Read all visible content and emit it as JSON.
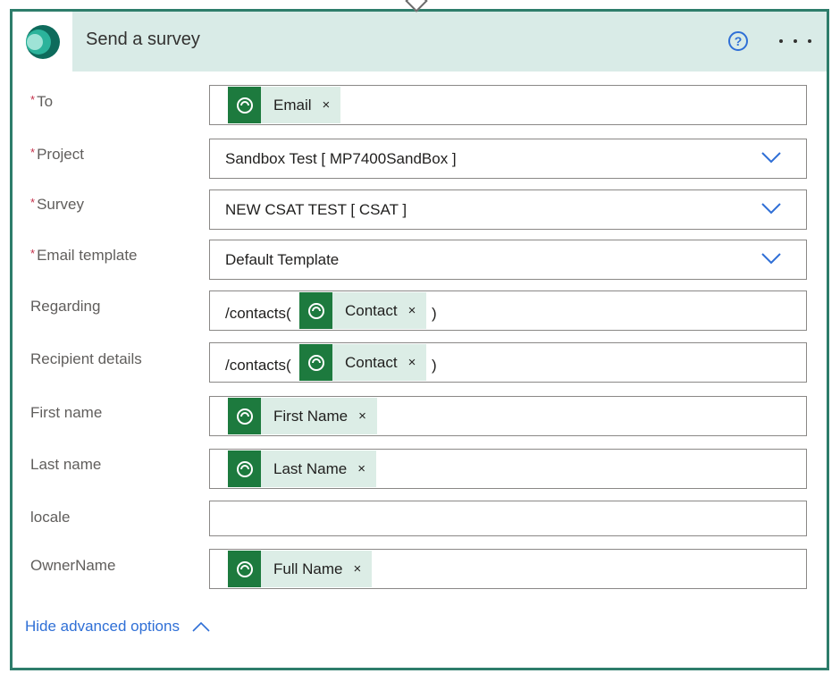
{
  "card": {
    "title": "Send a survey",
    "icons": {
      "logo": "forms-pro-logo-icon",
      "help": "question-circle-icon",
      "more": "ellipsis-icon"
    },
    "help_glyph": "?"
  },
  "colors": {
    "border": "#2e7d6b",
    "header_bg": "#d9ebe7",
    "token_bg": "#dcede6",
    "token_icon_bg": "#1d7a3e",
    "link": "#2f6fd6",
    "required": "#c4314b"
  },
  "fields": {
    "to": {
      "required": "*",
      "label": "To",
      "token": "Email",
      "remove": "×"
    },
    "project": {
      "required": "*",
      "label": "Project",
      "value": "Sandbox Test [ MP7400SandBox ]"
    },
    "survey": {
      "required": "*",
      "label": "Survey",
      "value": "NEW CSAT TEST [ CSAT ]"
    },
    "email_template": {
      "required": "*",
      "label": "Email template",
      "value": "Default Template"
    },
    "regarding": {
      "label": "Regarding",
      "prefix": "/contacts(",
      "token": "Contact",
      "remove": "×",
      "suffix": ")"
    },
    "recipient_details": {
      "label": "Recipient details",
      "prefix": "/contacts(",
      "token": "Contact",
      "remove": "×",
      "suffix": ")"
    },
    "first_name": {
      "label": "First name",
      "token": "First Name",
      "remove": "×"
    },
    "last_name": {
      "label": "Last name",
      "token": "Last Name",
      "remove": "×"
    },
    "locale": {
      "label": "locale",
      "value": ""
    },
    "owner_name": {
      "label": "OwnerName",
      "token": "Full Name",
      "remove": "×"
    }
  },
  "footer": {
    "advanced_label": "Hide advanced options",
    "icon": "chevron-up-icon"
  }
}
